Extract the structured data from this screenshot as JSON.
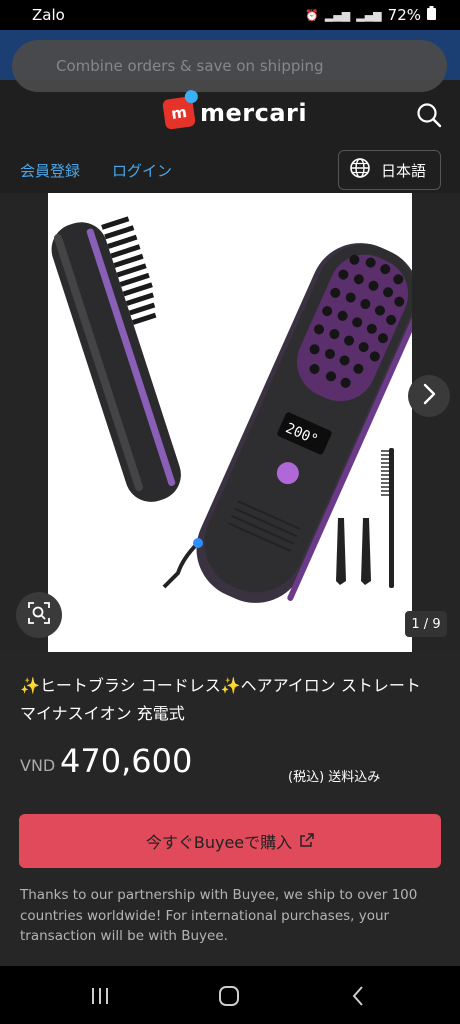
{
  "status_bar": {
    "carrier_app": "Zalo",
    "battery": "72%"
  },
  "toast": {
    "text": "Combine orders & save on shipping"
  },
  "header": {
    "logo_text": "mercari",
    "logo_mark": "m"
  },
  "nav": {
    "register": "会員登録",
    "login": "ログイン",
    "language": "日本語"
  },
  "gallery": {
    "counter": "1 / 9",
    "lcd_readout": "200°"
  },
  "item": {
    "title": "✨ヒートブラシ コードレス✨ヘアアイロン ストレート マイナスイオン 充電式",
    "currency": "VND",
    "price": "470,600",
    "tax_shipping": "(税込) 送料込み"
  },
  "purchase": {
    "button_label": "今すぐBuyeeで購入",
    "partnership_note": "Thanks to our partnership with Buyee, we ship to over 100 countries worldwide! For international purchases, your transaction will be with Buyee."
  },
  "colors": {
    "accent_red": "#e04a5a",
    "link_blue": "#4aa6e8",
    "brand_red": "#e5332a",
    "brand_blue": "#3ab0f5"
  },
  "icons": [
    "signal-icon",
    "battery-icon",
    "search-icon",
    "globe-icon",
    "chevron-right-icon",
    "lens-search-icon",
    "external-link-icon",
    "recent-apps-icon",
    "home-icon",
    "back-icon"
  ]
}
